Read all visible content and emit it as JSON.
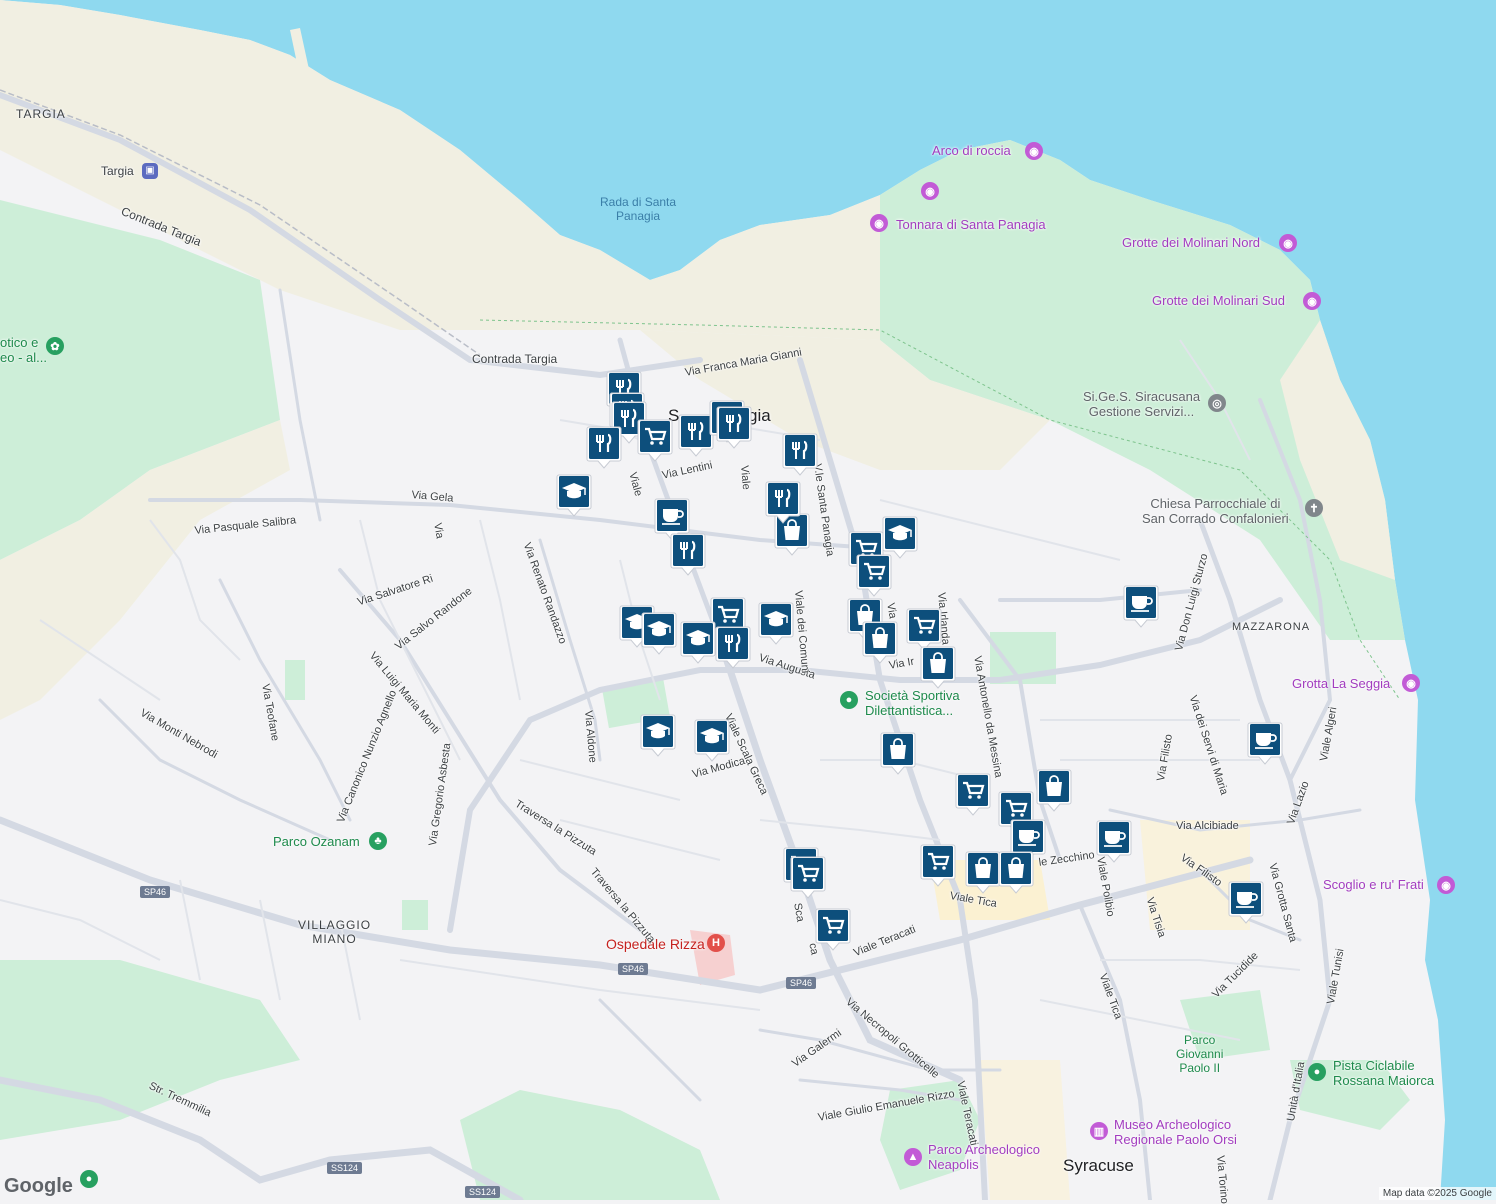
{
  "colors": {
    "water": "#8fd9ef",
    "land": "#f3f3f5",
    "sand": "#f1efe2",
    "park": "#cdeed8",
    "road": "#d4d9e3",
    "marker": "#0d4f7c"
  },
  "labels": {
    "targia_area": "TARGIA",
    "targia_station": "Targia",
    "contrada_targia_1": "Contrada Targia",
    "contrada_targia_2": "Contrada Targia",
    "rada_1": "Rada di Santa",
    "rada_2": "Panagia",
    "arco": "Arco di roccia",
    "tonnara": "Tonnara di Santa Panagia",
    "grotte_nord": "Grotte dei Molinari Nord",
    "grotte_sud": "Grotte dei Molinari Sud",
    "sigess_1": "Si.Ge.S. Siracusana",
    "sigess_2": "Gestione Servizi...",
    "chiesa_1": "Chiesa Parrocchiale di",
    "chiesa_2": "San Corrado Confalonieri",
    "mazzarona": "MAZZARONA",
    "grotta_seggia": "Grotta La Seggia",
    "scoglio": "Scoglio e ru' Frati",
    "pista_1": "Pista Ciclabile",
    "pista_2": "Rossana Maiorca",
    "parco_giovanni_1": "Parco",
    "parco_giovanni_2": "Giovanni",
    "parco_giovanni_3": "Paolo II",
    "museo_1": "Museo Archeologico",
    "museo_2": "Regionale Paolo Orsi",
    "syracuse": "Syracuse",
    "parco_neapolis_1": "Parco Archeologico",
    "parco_neapolis_2": "Neapolis",
    "ospedale": "Ospedale Rizza",
    "villaggio_1": "VILLAGGIO",
    "villaggio_2": "MIANO",
    "parco_ozanam": "Parco Ozanam",
    "societa_1": "Società Sportiva",
    "societa_2": "Dilettantistica...",
    "botanico_1": "otico e",
    "botanico_2": "eo - al...",
    "santa_panagia_partial_1": "S",
    "santa_panagia_partial_2": "gia",
    "sp46_a": "SP46",
    "sp46_b": "SP46",
    "sp46_c": "SP46",
    "ss124_a": "SS124",
    "ss124_b": "SS124"
  },
  "streets": [
    {
      "text": "Via Franca Maria Gianni"
    },
    {
      "text": "Via Lentini"
    },
    {
      "text": "Via Gela"
    },
    {
      "text": "Via Pasquale Salibra"
    },
    {
      "text": "Via Salvatore Ri"
    },
    {
      "text": "Via Salvo Randone"
    },
    {
      "text": "Via Renato Randazzo"
    },
    {
      "text": "Via Luigi Maria Monti"
    },
    {
      "text": "Via Canonico Nunzio Agnello"
    },
    {
      "text": "Via Gregorio Asbesta"
    },
    {
      "text": "Via Teofane"
    },
    {
      "text": "Via Monti Nebrodi"
    },
    {
      "text": "Via Aldone"
    },
    {
      "text": "Via Modica"
    },
    {
      "text": "Viale Scala Greca"
    },
    {
      "text": "Via Augusta"
    },
    {
      "text": "Viale dei Comuni"
    },
    {
      "text": "V.le Santa Panagia"
    },
    {
      "text": "Via Irlanda"
    },
    {
      "text": "Via Antonello da Messina"
    },
    {
      "text": "Via Don Luigi Sturzo"
    },
    {
      "text": "Via dei Servi di Maria"
    },
    {
      "text": "Via Lazio"
    },
    {
      "text": "Viale Algeri"
    },
    {
      "text": "Via Alcibiade"
    },
    {
      "text": "Via Filisto"
    },
    {
      "text": "Via Filisto"
    },
    {
      "text": "Via Grotta Santa"
    },
    {
      "text": "Via Tisia"
    },
    {
      "text": "Viale Polibio"
    },
    {
      "text": "Viale Tica"
    },
    {
      "text": "Viale Tica"
    },
    {
      "text": "le Zecchino"
    },
    {
      "text": "Via Tucidide"
    },
    {
      "text": "Viale Tunisi"
    },
    {
      "text": "Viale Teracati"
    },
    {
      "text": "Viale Teracati"
    },
    {
      "text": "Via Necropoli Grotticelle"
    },
    {
      "text": "Via Galermi"
    },
    {
      "text": "Viale Giulio Emanuele Rizzo"
    },
    {
      "text": "Traversa la Pizzuta"
    },
    {
      "text": "Traversa la Pizzuta"
    },
    {
      "text": "Str. Tremmilia"
    },
    {
      "text": "Sca"
    },
    {
      "text": "ca"
    },
    {
      "text": "Viale"
    },
    {
      "text": "Viale"
    },
    {
      "text": "Via"
    },
    {
      "text": "Via Ir"
    },
    {
      "text": "Via"
    },
    {
      "text": "Unità d'Italia"
    },
    {
      "text": "Via Torino"
    }
  ],
  "markers": [
    {
      "icon": "restaurant-icon"
    },
    {
      "icon": "restaurant-icon"
    },
    {
      "icon": "restaurant-icon"
    },
    {
      "icon": "shopping-cart-icon"
    },
    {
      "icon": "restaurant-icon"
    },
    {
      "icon": "restaurant-icon"
    },
    {
      "icon": "restaurant-icon"
    },
    {
      "icon": "restaurant-icon"
    },
    {
      "icon": "school-icon"
    },
    {
      "icon": "cafe-icon"
    },
    {
      "icon": "restaurant-icon"
    },
    {
      "icon": "restaurant-icon"
    },
    {
      "icon": "shopping-bag-icon"
    },
    {
      "icon": "restaurant-icon"
    },
    {
      "icon": "school-icon"
    },
    {
      "icon": "shopping-cart-icon"
    },
    {
      "icon": "shopping-cart-icon"
    },
    {
      "icon": "shopping-cart-icon"
    },
    {
      "icon": "school-icon"
    },
    {
      "icon": "school-icon"
    },
    {
      "icon": "school-icon"
    },
    {
      "icon": "restaurant-icon"
    },
    {
      "icon": "school-icon"
    },
    {
      "icon": "shopping-bag-icon"
    },
    {
      "icon": "shopping-bag-icon"
    },
    {
      "icon": "shopping-cart-icon"
    },
    {
      "icon": "shopping-bag-icon"
    },
    {
      "icon": "school-icon"
    },
    {
      "icon": "school-icon"
    },
    {
      "icon": "shopping-bag-icon"
    },
    {
      "icon": "cafe-icon"
    },
    {
      "icon": "shopping-cart-icon"
    },
    {
      "icon": "shopping-cart-icon"
    },
    {
      "icon": "shopping-bag-icon"
    },
    {
      "icon": "cafe-icon"
    },
    {
      "icon": "cafe-icon"
    },
    {
      "icon": "shopping-cart-icon"
    },
    {
      "icon": "shopping-bag-icon"
    },
    {
      "icon": "shopping-bag-icon"
    },
    {
      "icon": "cafe-icon"
    },
    {
      "icon": "cafe-icon"
    },
    {
      "icon": "shopping-cart-icon"
    },
    {
      "icon": "shopping-cart-icon"
    },
    {
      "icon": "shopping-cart-icon"
    }
  ],
  "attribution": "Map data ©2025 Google",
  "logo": "Google"
}
